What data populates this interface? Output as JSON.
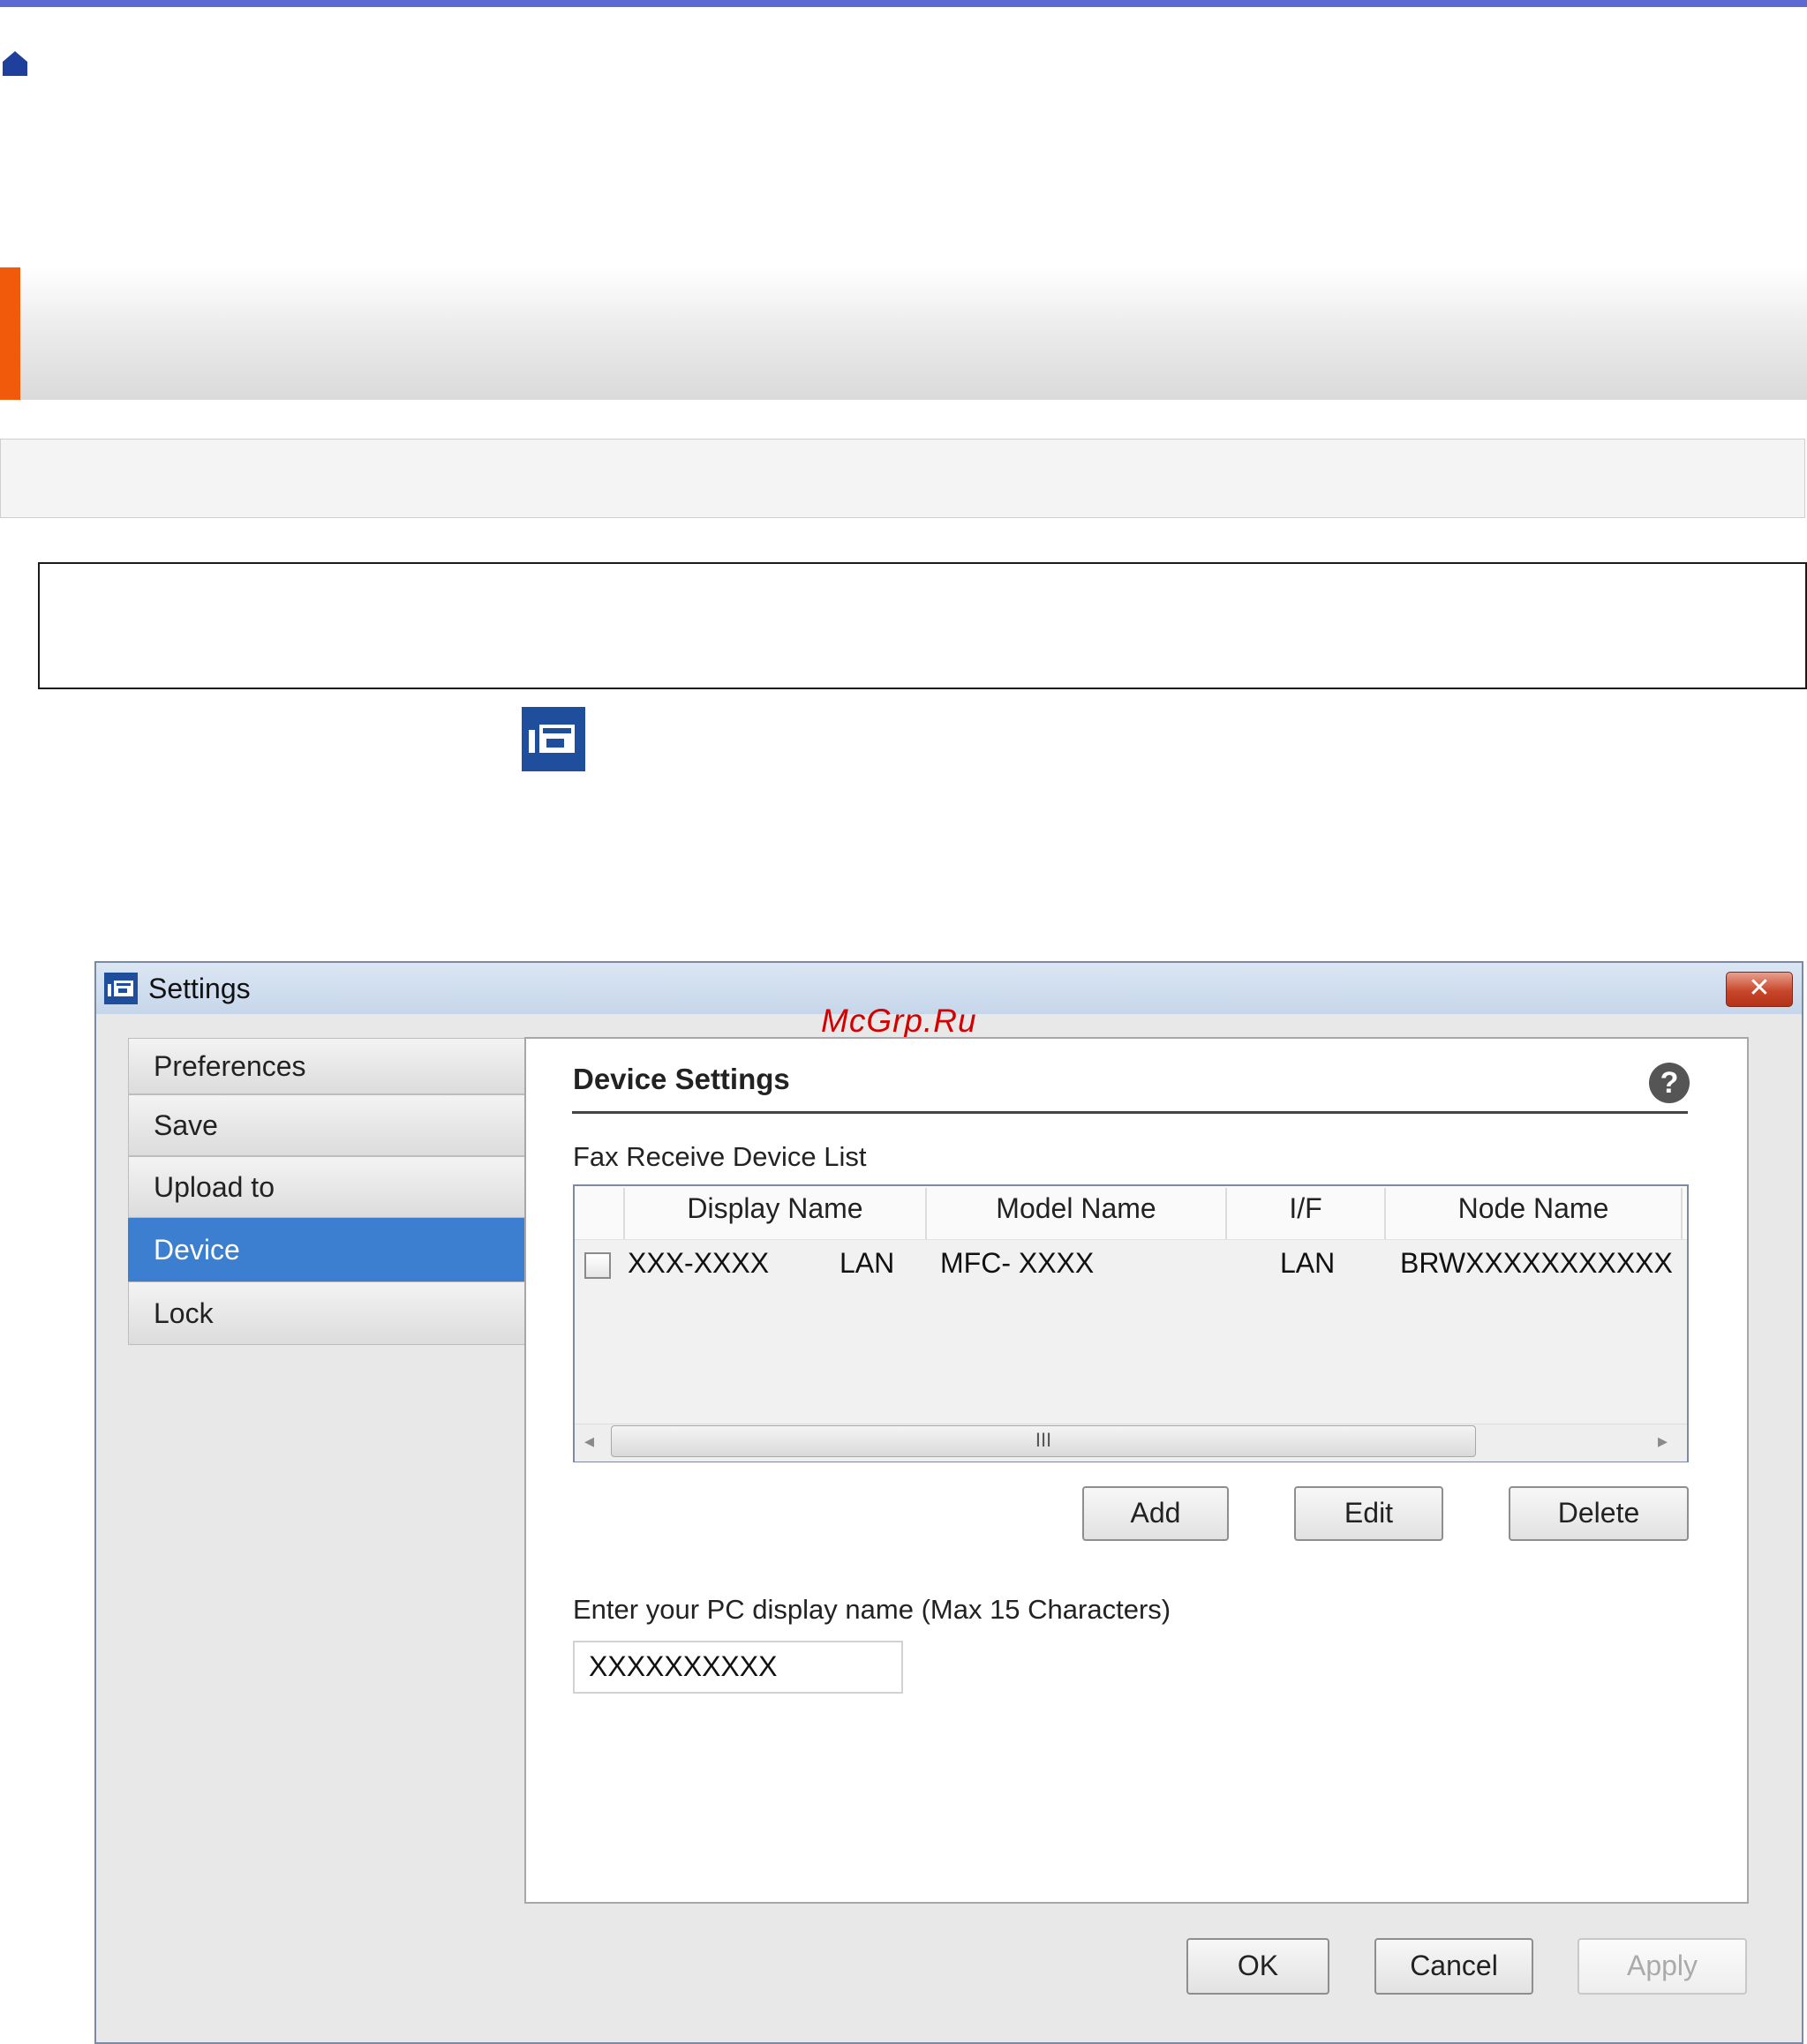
{
  "window": {
    "title": "Settings",
    "close_glyph": "✕"
  },
  "watermark": "McGrp.Ru",
  "sidebar": {
    "items": [
      {
        "label": "Preferences"
      },
      {
        "label": "Save"
      },
      {
        "label": "Upload to"
      },
      {
        "label": "Device",
        "selected": true
      },
      {
        "label": "Lock"
      }
    ]
  },
  "panel": {
    "title": "Device Settings",
    "help_glyph": "?",
    "list_label": "Fax Receive Device List",
    "columns": [
      "Display Name",
      "Model Name",
      "I/F",
      "Node Name"
    ],
    "rows": [
      {
        "display_name": "XXX-XXXX",
        "display_if": "LAN",
        "model_name": "MFC- XXXX",
        "if": "LAN",
        "node_name": "BRWXXXXXXXXXXX",
        "checked": false
      }
    ],
    "scroll_grip": "III",
    "scroll_left": "◂",
    "scroll_right": "▸",
    "buttons": {
      "add": "Add",
      "edit": "Edit",
      "delete": "Delete"
    },
    "pc_name_label": "Enter your PC display name (Max 15 Characters)",
    "pc_name_value": "XXXXXXXXXX"
  },
  "footer": {
    "ok": "OK",
    "cancel": "Cancel",
    "apply": "Apply",
    "apply_disabled": true
  },
  "colors": {
    "accent_orange": "#f05a0a",
    "topbar": "#5c6bd3",
    "selected_nav": "#3c7fd0",
    "app_icon": "#1f4f9c"
  },
  "icons": [
    "home-icon",
    "settings-app-icon",
    "close-icon",
    "help-icon"
  ]
}
